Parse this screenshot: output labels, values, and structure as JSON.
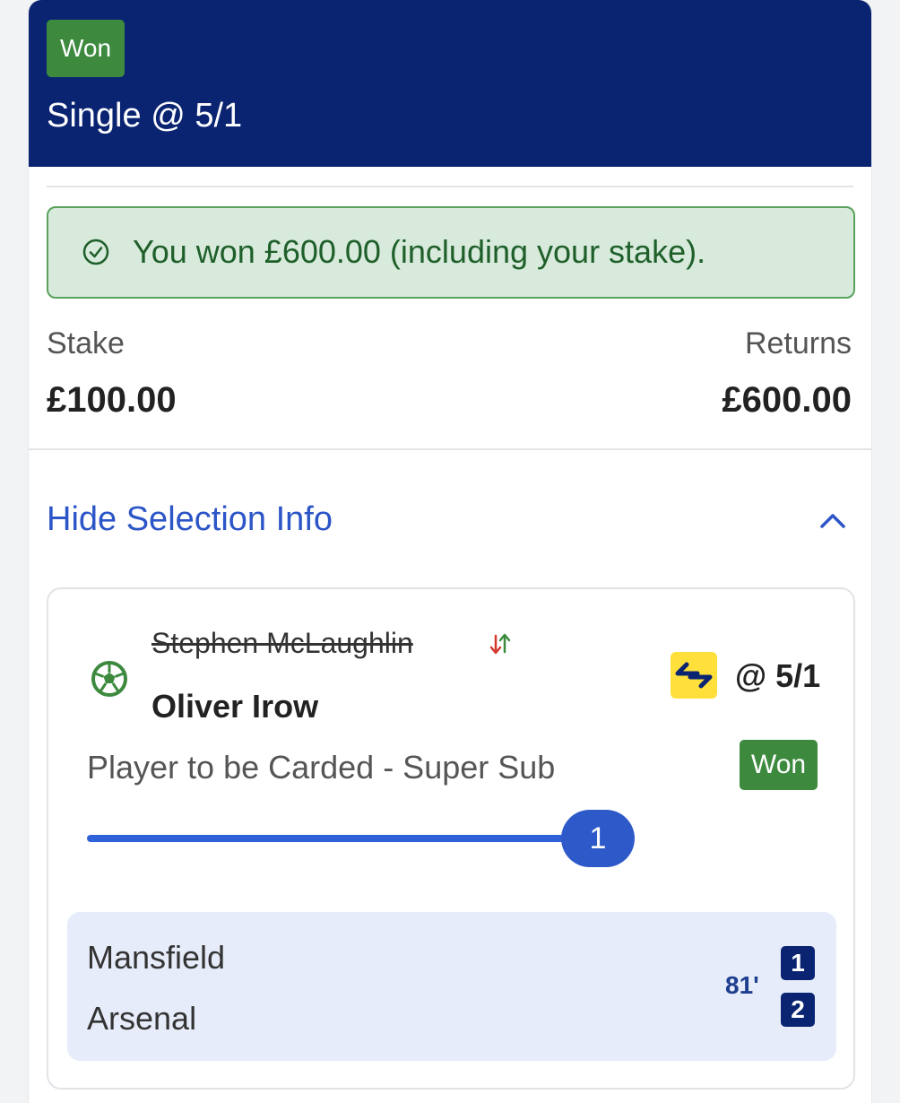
{
  "header": {
    "status_badge": "Won",
    "title": "Single @ 5/1"
  },
  "result": {
    "message": "You won £600.00 (including your stake)."
  },
  "summary": {
    "stake_label": "Stake",
    "stake_value": "£100.00",
    "returns_label": "Returns",
    "returns_value": "£600.00"
  },
  "toggle": {
    "label": "Hide Selection Info"
  },
  "selection": {
    "original_player": "Stephen McLaughlin",
    "player": "Oliver Irow",
    "odds": "@ 5/1",
    "market": "Player to be Carded - Super Sub",
    "status": "Won",
    "progress_count": "1",
    "progress_fraction": 1.0
  },
  "match": {
    "home_team": "Mansfield",
    "away_team": "Arsenal",
    "time": "81'",
    "home_score": "1",
    "away_score": "2"
  },
  "colors": {
    "header_bg": "#0a2472",
    "won_green": "#3d8a3f",
    "link_blue": "#2c55c7",
    "boost_yellow": "#ffe03a"
  },
  "icons": {
    "result": "check-circle-icon",
    "toggle": "chevron-up-icon",
    "sport": "football-icon",
    "swap": "swap-arrows-icon",
    "boost": "super-sub-icon"
  }
}
